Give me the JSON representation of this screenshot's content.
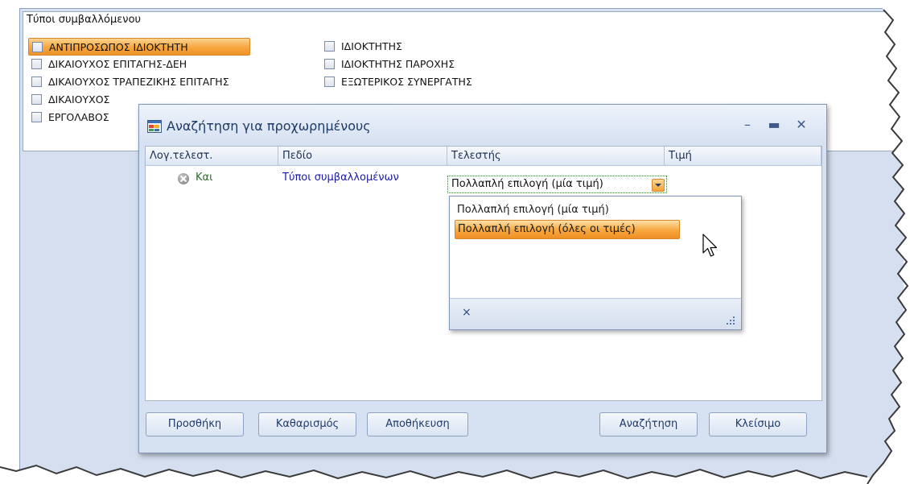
{
  "group": {
    "title": "Τύποι συμβαλλόμενου",
    "options": [
      {
        "label": "ΑΝΤΙΠΡΟΣΩΠΟΣ ΙΔΙΟΚΤΗΤΗ",
        "selected": true
      },
      {
        "label": "ΔΙΚΑΙΟΥΧΟΣ ΕΠΙΤΑΓΗΣ-ΔΕΗ",
        "selected": false
      },
      {
        "label": "ΔΙΚΑΙΟΥΧΟΣ ΤΡΑΠΕΖΙΚΗΣ ΕΠΙΤΑΓΗΣ",
        "selected": false
      },
      {
        "label": "ΔΙΚΑΙΟΥΧΟΣ",
        "selected": false
      },
      {
        "label": "ΕΡΓΟΛΑΒΟΣ",
        "selected": false
      },
      {
        "label": "ΙΔΙΟΚΤΗΤΗΣ",
        "selected": false
      },
      {
        "label": "ΙΔΙΟΚΤΗΤΗΣ ΠΑΡΟΧΗΣ",
        "selected": false
      },
      {
        "label": "ΕΞΩΤΕΡΙΚΟΣ ΣΥΝΕΡΓΑΤΗΣ",
        "selected": false
      }
    ]
  },
  "dialog": {
    "title": "Αναζήτηση για προχωρημένους",
    "columns": [
      "Λογ.τελεστ.",
      "Πεδίο",
      "Τελεστής",
      "Τιμή"
    ],
    "row": {
      "logic": "Και",
      "field": "Τύποι συμβαλλομένων",
      "operator": "Πολλαπλή επιλογή (μία τιμή)"
    },
    "dropdown": {
      "options": [
        "Πολλαπλή επιλογή (μία τιμή)",
        "Πολλαπλή επιλογή (όλες οι τιμές)"
      ],
      "highlighted_index": 1,
      "clear_label": "×"
    },
    "buttons": {
      "add": "Προσθήκη",
      "clear": "Καθαρισμός",
      "save": "Αποθήκευση",
      "search": "Αναζήτηση",
      "close": "Κλείσιμο"
    }
  },
  "colors": {
    "selection": "#f6a63d",
    "window_bg": "#d5dfef",
    "field_link": "#1a1aa6"
  }
}
